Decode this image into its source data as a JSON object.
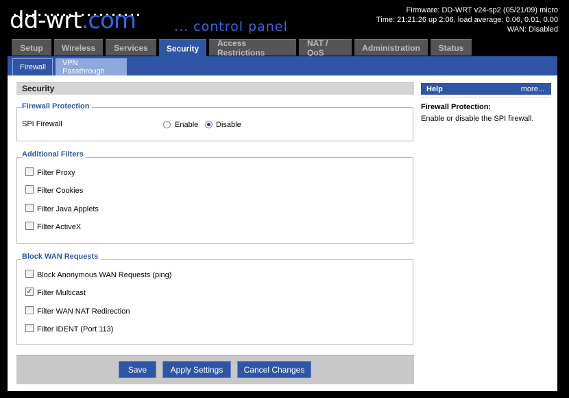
{
  "logo": {
    "main": "dd-wrt",
    "suffix": ".com",
    "tagline": "... control panel"
  },
  "fw": {
    "line1": "Firmware: DD-WRT v24-sp2 (05/21/09) micro",
    "line2": "Time: 21:21:26 up 2:06, load average: 0.06, 0.01, 0.00",
    "line3": "WAN: Disabled"
  },
  "tabs": [
    "Setup",
    "Wireless",
    "Services",
    "Security",
    "Access Restrictions",
    "NAT / QoS",
    "Administration",
    "Status"
  ],
  "active_tab": "Security",
  "subtabs": [
    "Firewall",
    "VPN Passthrough"
  ],
  "section_title": "Security",
  "firewall": {
    "title": "Firewall Protection",
    "spi_label": "SPI Firewall",
    "enable": "Enable",
    "disable": "Disable",
    "selected": "Disable"
  },
  "additional": {
    "title": "Additional Filters",
    "items": [
      {
        "label": "Filter Proxy",
        "checked": false
      },
      {
        "label": "Filter Cookies",
        "checked": false
      },
      {
        "label": "Filter Java Applets",
        "checked": false
      },
      {
        "label": "Filter ActiveX",
        "checked": false
      }
    ]
  },
  "block": {
    "title": "Block WAN Requests",
    "items": [
      {
        "label": "Block Anonymous WAN Requests (ping)",
        "checked": false
      },
      {
        "label": "Filter Multicast",
        "checked": true
      },
      {
        "label": "Filter WAN NAT Redirection",
        "checked": false
      },
      {
        "label": "Filter IDENT (Port 113)",
        "checked": false
      }
    ]
  },
  "buttons": {
    "save": "Save",
    "apply": "Apply Settings",
    "cancel": "Cancel Changes"
  },
  "help": {
    "title": "Help",
    "more": "more...",
    "item_title": "Firewall Protection:",
    "item_text": "Enable or disable the SPI firewall."
  },
  "colors": {
    "accent": "#2f55a6",
    "subtab_inactive": "#8ea8dd",
    "section_bg": "#d4d4d4"
  }
}
